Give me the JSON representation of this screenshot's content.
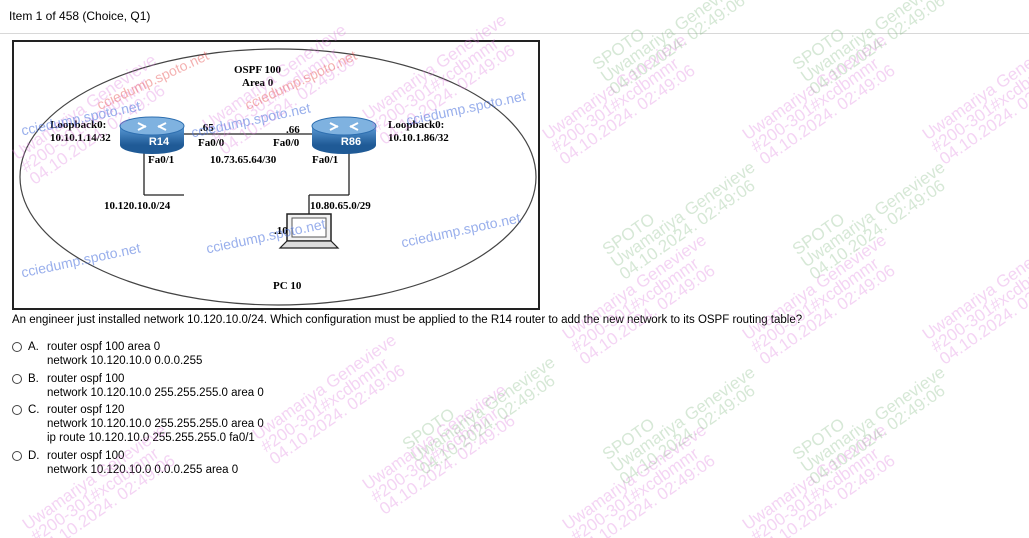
{
  "header": {
    "item_label": "Item 1 of 458  (Choice, Q1)"
  },
  "diagram": {
    "area_title": "OSPF 100",
    "area_subtitle": "Area 0",
    "r14": {
      "name": "R14",
      "loopback_label": "Loopback0:",
      "loopback_ip": "10.10.1.14/32",
      "fa00": "Fa0/0",
      "fa01": "Fa0/1",
      "host_octet": ".65"
    },
    "r86": {
      "name": "R86",
      "loopback_label": "Loopback0:",
      "loopback_ip": "10.10.1.86/32",
      "fa00": "Fa0/0",
      "fa01": "Fa0/1",
      "host_octet": ".66"
    },
    "link_network": "10.73.65.64/30",
    "lan_r14": "10.120.10.0/24",
    "lan_r86": "10.80.65.0/29",
    "pc": {
      "name": "PC 10",
      "host_octet": ".10"
    }
  },
  "question": {
    "text": "An engineer just installed network 10.120.10.0/24. Which configuration must be applied to the R14 router to add the new network to its OSPF routing table?"
  },
  "options": [
    {
      "letter": "A.",
      "lines": [
        "router ospf 100 area 0",
        "network 10.120.10.0 0.0.0.255"
      ]
    },
    {
      "letter": "B.",
      "lines": [
        "router ospf 100",
        "network 10.120.10.0 255.255.255.0 area 0"
      ]
    },
    {
      "letter": "C.",
      "lines": [
        "router ospf 120",
        "network 10.120.10.0 255.255.255.0 area 0",
        "ip route 10.120.10.0 255.255.255.0 fa0/1"
      ]
    },
    {
      "letter": "D.",
      "lines": [
        "router ospf 100",
        "network 10.120.10.0 0.0.0.255 area 0"
      ]
    }
  ],
  "watermark": {
    "line1": "Uwamariya Genevieve",
    "line2": "SPOTO",
    "line3": "#200-301#xcdbmmr",
    "line4": "04.10.2024. 02:49:06",
    "site_mark": "cciedump.spoto.net"
  },
  "colors": {
    "router_blue": "#2e6fb0",
    "watermark_pink": "#dc78dc"
  }
}
